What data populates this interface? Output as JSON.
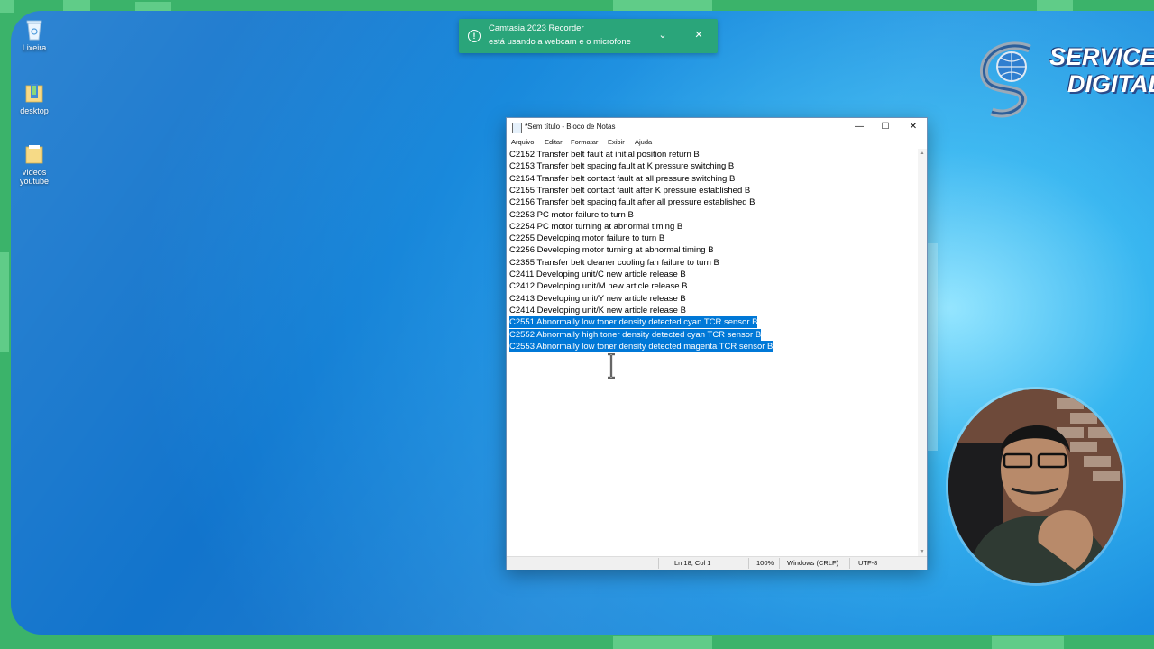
{
  "desktop": {
    "icons": [
      {
        "label_1": "Lixeira",
        "label_2": ""
      },
      {
        "label_1": "desktop",
        "label_2": ""
      },
      {
        "label_1": "vídeos",
        "label_2": "youtube"
      }
    ]
  },
  "toast": {
    "title": "Camtasia 2023 Recorder",
    "message": "está usando a webcam e o microfone",
    "accent": "#2aa57a"
  },
  "logo": {
    "line1": "SERVICE",
    "line2": "DIGITAL"
  },
  "notepad": {
    "window_title": "*Sem título - Bloco de Notas",
    "menu": [
      "Arquivo",
      "Editar",
      "Formatar",
      "Exibir",
      "Ajuda"
    ],
    "lines": [
      {
        "text": "C2152 Transfer belt fault at initial position return B",
        "selected": false
      },
      {
        "text": "C2153 Transfer belt spacing fault at K pressure switching B",
        "selected": false
      },
      {
        "text": "C2154 Transfer belt contact fault at all pressure switching B",
        "selected": false
      },
      {
        "text": "C2155 Transfer belt contact fault after K pressure established B",
        "selected": false
      },
      {
        "text": "C2156 Transfer belt spacing fault after all pressure established B",
        "selected": false
      },
      {
        "text": "C2253 PC motor failure to turn B",
        "selected": false
      },
      {
        "text": "C2254 PC motor turning at abnormal timing B",
        "selected": false
      },
      {
        "text": "C2255 Developing motor failure to turn B",
        "selected": false
      },
      {
        "text": "C2256 Developing motor turning at abnormal timing B",
        "selected": false
      },
      {
        "text": "C2355 Transfer belt cleaner cooling fan failure to turn B",
        "selected": false
      },
      {
        "text": "C2411 Developing unit/C new article release B",
        "selected": false
      },
      {
        "text": "C2412 Developing unit/M new article release B",
        "selected": false
      },
      {
        "text": "C2413 Developing unit/Y new article release B",
        "selected": false
      },
      {
        "text": "C2414 Developing unit/K new article release B",
        "selected": false
      },
      {
        "text": "C2551 Abnormally low toner density detected cyan TCR sensor B",
        "selected": true
      },
      {
        "text": "C2552 Abnormally high toner density detected cyan TCR sensor B",
        "selected": true
      },
      {
        "text": "C2553 Abnormally low toner density detected magenta TCR sensor B",
        "selected": true
      }
    ],
    "status": {
      "position": "Ln 18, Col 1",
      "zoom": "100%",
      "line_ending": "Windows (CRLF)",
      "encoding": "UTF-8"
    },
    "selection_color": "#0078d7"
  }
}
